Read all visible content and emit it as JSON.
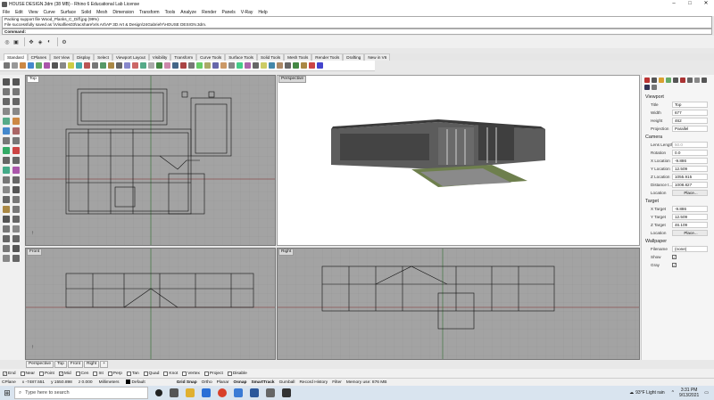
{
  "window": {
    "title": "HOUSE DESIGN.3dm (38 MB) - Rhino 6 Educational Lab License",
    "minimize": "–",
    "maximize": "□",
    "close": "✕"
  },
  "menu": [
    "File",
    "Edit",
    "View",
    "Curve",
    "Surface",
    "Solid",
    "Mesh",
    "Dimension",
    "Transform",
    "Tools",
    "Analyze",
    "Render",
    "Panels",
    "V-Ray",
    "Help"
  ],
  "history": [
    "Packing support file Wood_Planks_C_Diff.jpg (99%)",
    "File successfully saved as \\\\Visaflies03\\racshare\\Vis Art\\AP 3D Art & Design\\24GabrielY\\HOUSE DESIGN.3dm."
  ],
  "command": {
    "label": "Command:"
  },
  "toolbar_tabs": [
    {
      "label": "Standard",
      "active": true
    },
    {
      "label": "CPlanes"
    },
    {
      "label": "Set View"
    },
    {
      "label": "Display"
    },
    {
      "label": "Select"
    },
    {
      "label": "Viewport Layout"
    },
    {
      "label": "Visibility"
    },
    {
      "label": "Transform"
    },
    {
      "label": "Curve Tools"
    },
    {
      "label": "Surface Tools"
    },
    {
      "label": "Solid Tools"
    },
    {
      "label": "Mesh Tools"
    },
    {
      "label": "Render Tools"
    },
    {
      "label": "Drafting"
    },
    {
      "label": "New in V6"
    }
  ],
  "viewports": {
    "top": "Top",
    "perspective": "Perspective",
    "front": "Front",
    "right": "Right"
  },
  "viewport_tabs": [
    "Perspective",
    "Top",
    "Front",
    "Right",
    "+"
  ],
  "properties": {
    "viewport_header": "Viewport",
    "viewport": [
      {
        "k": "Title",
        "v": "Top"
      },
      {
        "k": "Width",
        "v": "677"
      },
      {
        "k": "Height",
        "v": "462"
      },
      {
        "k": "Projection",
        "v": "Parallel"
      }
    ],
    "camera_header": "Camera",
    "camera": [
      {
        "k": "Lens Length",
        "v": "50.0",
        "disabled": true
      },
      {
        "k": "Rotation",
        "v": "0.0"
      },
      {
        "k": "X Location",
        "v": "-9.886"
      },
      {
        "k": "Y Location",
        "v": "12.509"
      },
      {
        "k": "Z Location",
        "v": "1055.915"
      },
      {
        "k": "Distance t...",
        "v": "1008.827"
      },
      {
        "k": "Location",
        "v": "Place..."
      }
    ],
    "target_header": "Target",
    "target": [
      {
        "k": "X Target",
        "v": "-9.886"
      },
      {
        "k": "Y Target",
        "v": "12.509"
      },
      {
        "k": "Z Target",
        "v": "46.109"
      },
      {
        "k": "Location",
        "v": "Place..."
      }
    ],
    "wallpaper_header": "Wallpaper",
    "wallpaper": [
      {
        "k": "Filename",
        "v": "(none)"
      }
    ],
    "wallpaper_checks": [
      {
        "k": "Show",
        "checked": true
      },
      {
        "k": "Gray",
        "checked": true
      }
    ]
  },
  "osnaps": [
    {
      "label": "End",
      "checked": true
    },
    {
      "label": "Near",
      "checked": false
    },
    {
      "label": "Point",
      "checked": false
    },
    {
      "label": "Mid",
      "checked": true
    },
    {
      "label": "Cen",
      "checked": false
    },
    {
      "label": "Int",
      "checked": false
    },
    {
      "label": "Perp",
      "checked": false
    },
    {
      "label": "Tan",
      "checked": false
    },
    {
      "label": "Quad",
      "checked": false
    },
    {
      "label": "Knot",
      "checked": false
    },
    {
      "label": "Vertex",
      "checked": false
    },
    {
      "label": "Project",
      "checked": false
    },
    {
      "label": "Disable",
      "checked": false
    }
  ],
  "status": {
    "cplane": "CPlane",
    "x": "x -7487.551",
    "y": "y 1550.898",
    "z": "z 0.000",
    "units": "Millimeters",
    "layer": "Default",
    "toggles": [
      "Grid Snap",
      "Ortho",
      "Planar",
      "Osnap",
      "SmartTrack",
      "Gumball",
      "Record History",
      "Filter"
    ],
    "memory": "Memory use: 876 MB"
  },
  "taskbar": {
    "search": "Type here to search",
    "weather": "93°F Light rain",
    "time": "3:31 PM",
    "date": "9/13/2021"
  },
  "icons": {
    "windows": "windows-icon",
    "search": "search-icon",
    "cortana": "cortana-icon",
    "taskview": "task-view-icon"
  }
}
